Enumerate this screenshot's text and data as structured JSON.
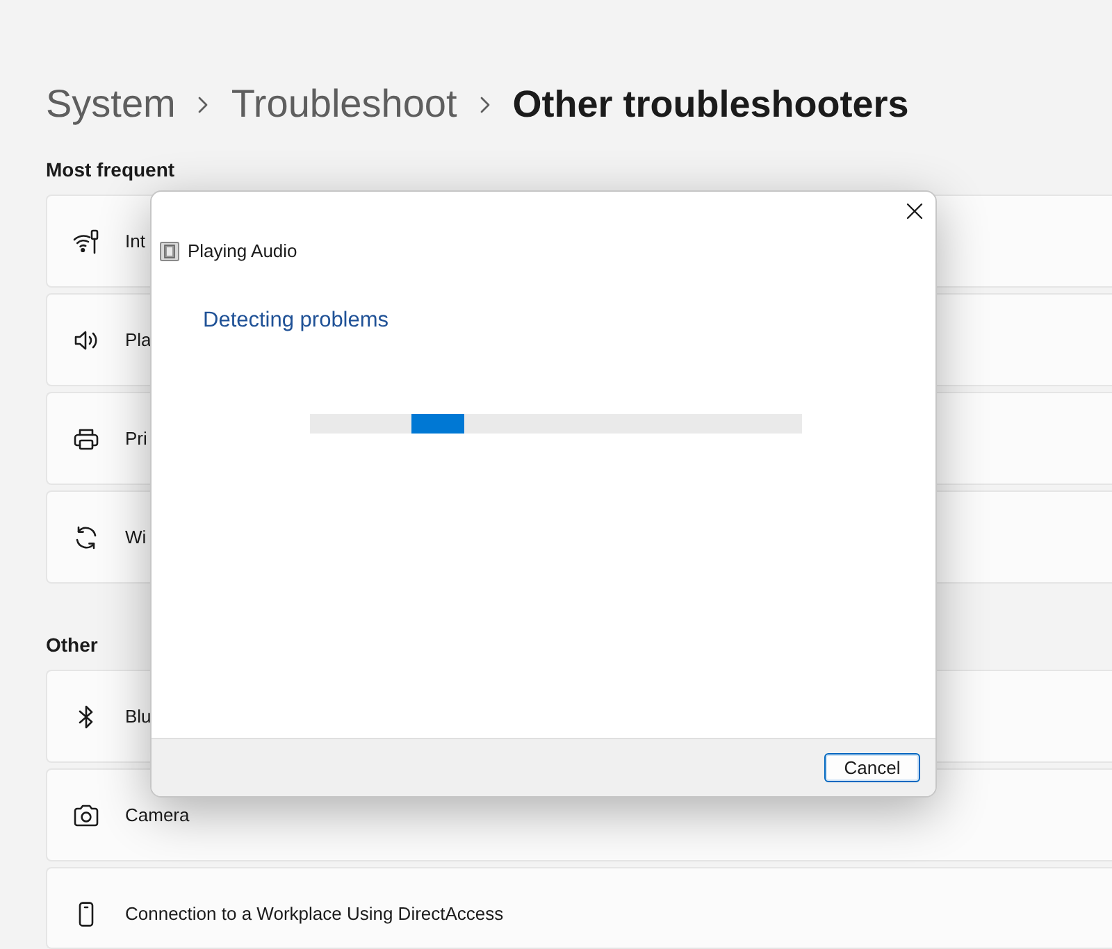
{
  "breadcrumb": [
    {
      "label": "System",
      "current": false
    },
    {
      "label": "Troubleshoot",
      "current": false
    },
    {
      "label": "Other troubleshooters",
      "current": true
    }
  ],
  "sections": [
    {
      "heading": "Most frequent",
      "items": [
        {
          "kind": "wifi",
          "label": "Int"
        },
        {
          "kind": "speaker",
          "label": "Pla"
        },
        {
          "kind": "printer",
          "label": "Pri"
        },
        {
          "kind": "refresh",
          "label": "Wi"
        }
      ]
    },
    {
      "heading": "Other",
      "items": [
        {
          "kind": "bluetooth",
          "label": "Blu"
        },
        {
          "kind": "camera",
          "label": "Camera"
        },
        {
          "kind": "phone",
          "label": "Connection to a Workplace Using DirectAccess"
        }
      ]
    }
  ],
  "dialog": {
    "title": "Playing Audio",
    "status": "Detecting problems",
    "progress": {
      "indeterminate": true
    },
    "buttons": [
      {
        "label": "Cancel",
        "default": true
      }
    ]
  }
}
